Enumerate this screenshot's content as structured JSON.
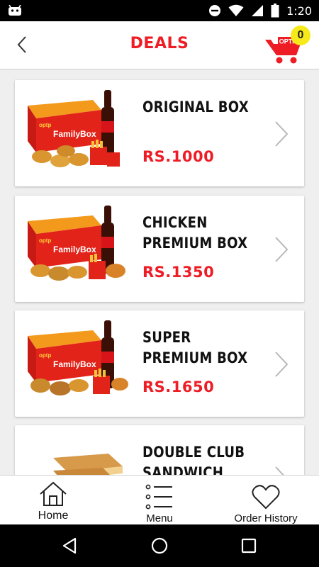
{
  "status_bar": {
    "time": "1:20"
  },
  "header": {
    "title": "DEALS",
    "cart_badge": "0",
    "cart_logo_text": "OPTP"
  },
  "deals": [
    {
      "name": "ORIGINAL BOX",
      "price": "RS.1000",
      "box_brand": "FamilyBox",
      "box_logo": "optp"
    },
    {
      "name": "CHICKEN PREMIUM BOX",
      "price": "RS.1350",
      "box_brand": "FamilyBox",
      "box_logo": "optp"
    },
    {
      "name": "SUPER PREMIUM BOX",
      "price": "RS.1650",
      "box_brand": "FamilyBox",
      "box_logo": "optp"
    },
    {
      "name": "DOUBLE CLUB SANDWICH DEAL",
      "price": "",
      "box_brand": "",
      "box_logo": ""
    }
  ],
  "bottom_nav": {
    "items": [
      {
        "label": "Home",
        "icon": "home-icon"
      },
      {
        "label": "Menu",
        "icon": "menu-icon"
      },
      {
        "label": "Order History",
        "icon": "heart-icon"
      }
    ]
  },
  "colors": {
    "accent": "#ee1c25",
    "badge": "#f6ea1a",
    "header_bg": "#ffffff",
    "list_bg": "#efefef"
  }
}
